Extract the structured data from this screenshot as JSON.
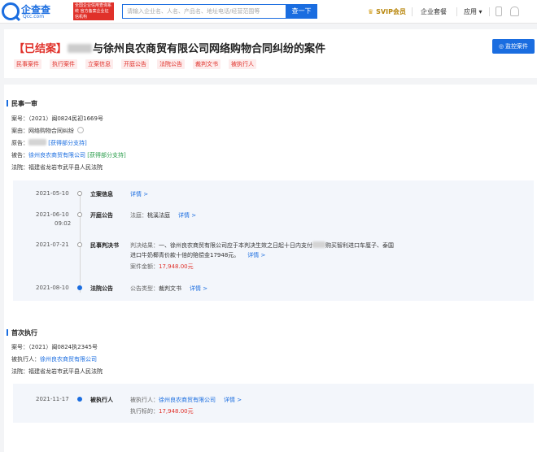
{
  "topbar": {
    "logo_name": "企查查",
    "logo_domain": "Qcc.com",
    "badge_text": "全国企业信用查询系统 官方备案企业征信机构",
    "search_placeholder": "请输入企业名、人名、产品名、地址电话/经营范围等",
    "search_button": "查一下",
    "svip": "SVIP会员",
    "nav_enterprise": "企业套餐",
    "nav_apps": "应用",
    "nav_apps_caret": "▾"
  },
  "header": {
    "status": "【已结案】",
    "title_rest": "与徐州良农商贸有限公司网络购物合同纠纷的案件",
    "monitor_icon": "◎",
    "monitor_label": "监控案件",
    "tags": [
      "民事案件",
      "执行案件",
      "立案信息",
      "开庭公告",
      "法院公告",
      "裁判文书",
      "被执行人"
    ]
  },
  "sections": {
    "civil": {
      "title": "民事一审",
      "case_no_label": "案号：",
      "case_no": "（2021）闽0824民初1669号",
      "cause_label": "案由：",
      "cause": "网络购物合同纠纷",
      "plaintiff_label": "原告：",
      "plaintiff_note": "[获得部分支持]",
      "defendant_label": "被告：",
      "defendant": "徐州良农商贸有限公司",
      "defendant_note": "[获得部分支持]",
      "court_label": "法院：",
      "court": "福建省龙岩市武平县人民法院",
      "timeline": [
        {
          "date": "2021-05-10",
          "time": "",
          "type": "立案信息",
          "detail": "详情 >"
        },
        {
          "date": "2021-06-10",
          "time": "09:02",
          "type": "开庭公告",
          "label": "法庭：",
          "value": "桃溪法庭",
          "detail": "详情 >"
        },
        {
          "date": "2021-07-21",
          "time": "",
          "type": "民事判决书",
          "label": "判决结果：",
          "line1": "一、徐州良农商贸有限公司应于本判决生效之日起十日内支付",
          "line1b": "购买智利进口车厘子、泰国",
          "line2": "进口牛奶椰青价款十倍的赔偿金17948元。",
          "detail": "详情 >",
          "amount_label": "案件金额：",
          "amount": "17,948.00元"
        },
        {
          "date": "2021-08-10",
          "time": "",
          "type": "法院公告",
          "label": "公告类型：",
          "value": "裁判文书",
          "detail": "详情 >"
        }
      ]
    },
    "exec": {
      "title": "首次执行",
      "case_no_label": "案号：",
      "case_no": "（2021）闽0824执2345号",
      "executee_label": "被执行人：",
      "executee": "徐州良农商贸有限公司",
      "court_label": "法院：",
      "court": "福建省龙岩市武平县人民法院",
      "timeline": [
        {
          "date": "2021-11-17",
          "type": "被执行人",
          "label": "被执行人：",
          "value": "徐州良农商贸有限公司",
          "detail": "详情 >",
          "target_label": "执行标的：",
          "target": "17,948.00元"
        }
      ]
    }
  },
  "colors": {
    "primary": "#1a6de0",
    "danger": "#e0312a",
    "tag_bg": "#fdecec",
    "gold": "#b8860b"
  }
}
